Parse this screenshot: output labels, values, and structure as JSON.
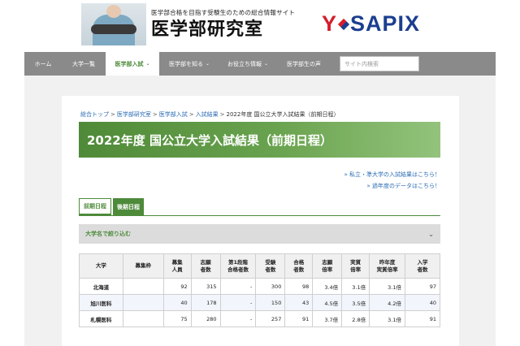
{
  "header": {
    "tagline": "医学部合格を目指す受験生のための総合情報サイト",
    "site_title": "医学部研究室",
    "logo_initial": "Y",
    "logo_text": "SAPIX"
  },
  "nav": {
    "items": [
      {
        "label": "ホーム",
        "has_dropdown": false,
        "active": false
      },
      {
        "label": "大学一覧",
        "has_dropdown": false,
        "active": false
      },
      {
        "label": "医学部入試",
        "has_dropdown": true,
        "active": true
      },
      {
        "label": "医学部を知る",
        "has_dropdown": true,
        "active": false
      },
      {
        "label": "お役立ち情報",
        "has_dropdown": true,
        "active": false
      },
      {
        "label": "医学部生の声",
        "has_dropdown": false,
        "active": false
      }
    ],
    "search_placeholder": "サイト内検索"
  },
  "breadcrumb": {
    "items": [
      "総合トップ",
      "医学部研究室",
      "医学部入試",
      "入試結果"
    ],
    "current": "2022年度 国公立大学入試結果（前期日程）",
    "separator": ">"
  },
  "page_title": "2022年度 国公立大学入試結果（前期日程）",
  "links": {
    "private_results": "» 私立・準大学の入試結果はこちら！",
    "past_data": "» 過年度のデータはこちら！"
  },
  "tabs": [
    {
      "label": "前期日程",
      "active": true
    },
    {
      "label": "後期日程",
      "active": false
    }
  ],
  "filter": {
    "label": "大学名で絞り込む",
    "chevron": "chevron-down-icon"
  },
  "table": {
    "headers": [
      "大学",
      "募集枠",
      "募集人員",
      "志願者数",
      "第1段階合格者数",
      "受験者数",
      "合格者数",
      "志願倍率",
      "実質倍率",
      "昨年度実質倍率",
      "入学者数"
    ],
    "header_lines": [
      [
        "大学"
      ],
      [
        "募集枠"
      ],
      [
        "募集",
        "人員"
      ],
      [
        "志願",
        "者数"
      ],
      [
        "第1段階",
        "合格者数"
      ],
      [
        "受験",
        "者数"
      ],
      [
        "合格",
        "者数"
      ],
      [
        "志願",
        "倍率"
      ],
      [
        "実質",
        "倍率"
      ],
      [
        "昨年度",
        "実質倍率"
      ],
      [
        "入学",
        "者数"
      ]
    ],
    "rows": [
      [
        "北海道",
        "",
        "92",
        "315",
        "-",
        "300",
        "98",
        "3.4倍",
        "3.1倍",
        "3.1倍",
        "97"
      ],
      [
        "旭川医科",
        "",
        "40",
        "178",
        "-",
        "150",
        "43",
        "4.5倍",
        "3.5倍",
        "4.2倍",
        "40"
      ],
      [
        "札幌医科",
        "",
        "75",
        "280",
        "-",
        "257",
        "91",
        "3.7倍",
        "2.8倍",
        "3.1倍",
        "91"
      ]
    ]
  },
  "colors": {
    "accent_green": "#4d8a3a",
    "nav_gray": "#8a8a8a",
    "link_blue": "#2a6bb3",
    "logo_red": "#d51d2c",
    "logo_blue": "#1b3e8f"
  }
}
